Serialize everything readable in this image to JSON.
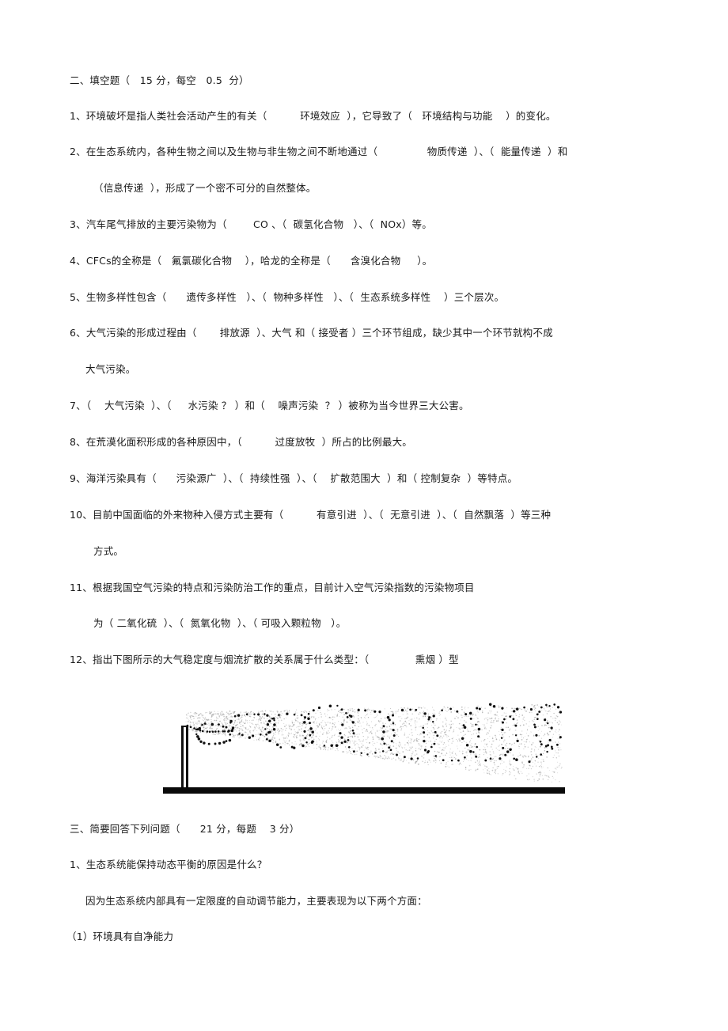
{
  "section2": {
    "heading": "二、填空题（   15 分，每空   0.5  分）",
    "questions": [
      {
        "id": "q1",
        "lines": [
          "1、环境破坏是指人类社会活动产生的有关（          环境效应  ），它导致了（   环境结构与功能    ）的变化。"
        ]
      },
      {
        "id": "q2",
        "lines": [
          "2、在生态系统内，各种生物之间以及生物与非生物之间不断地通过（               物质传递  ）、（  能量传递  ）和",
          "（信息传递  ），形成了一个密不可分的自然整体。"
        ]
      },
      {
        "id": "q3",
        "lines": [
          "3、汽车尾气排放的主要污染物为（        CO 、（  碳氢化合物   ）、（  NOx）等。"
        ]
      },
      {
        "id": "q4",
        "lines": [
          "4、CFCs的全称是（   氟氯碳化合物    ），哈龙的全称是（      含溴化合物     ）。"
        ]
      },
      {
        "id": "q5",
        "lines": [
          "5、生物多样性包含（      遗传多样性   ）、（  物种多样性   ）、（  生态系统多样性    ）三个层次。"
        ]
      },
      {
        "id": "q6",
        "lines": [
          "6、大气污染的形成过程由（       排放源  ）、大气 和（ 接受者 ）三个环节组成，缺少其中一个环节就构不成",
          "大气污染。"
        ]
      },
      {
        "id": "q7",
        "lines": [
          "7、（    大气污染  ）、（     水污染 ？ ）和（    噪声污染  ？ ）被称为当今世界三大公害。"
        ]
      },
      {
        "id": "q8",
        "lines": [
          "8、在荒漠化面积形成的各种原因中，（          过度放牧  ）所占的比例最大。"
        ]
      },
      {
        "id": "q9",
        "lines": [
          "9、海洋污染具有（      污染源广  ）、（  持续性强  ）、（    扩散范围大  ）和（ 控制复杂  ）等特点。"
        ]
      },
      {
        "id": "q10",
        "lines": [
          "10、目前中国面临的外来物种入侵方式主要有（          有意引进  ）、（  无意引进  ）、（  自然飘落  ）等三种",
          "方式。"
        ]
      },
      {
        "id": "q11",
        "lines": [
          "11、根据我国空气污染的特点和污染防治工作的重点，目前计入空气污染指数的污染物项目",
          "为（ 二氧化硫  ）、（  氮氧化物  ）、（ 可吸入颗粒物   ）。"
        ]
      },
      {
        "id": "q12",
        "lines": [
          "12、指出下图所示的大气稳定度与烟流扩散的关系属于什么类型：（              熏烟 ）型"
        ]
      }
    ],
    "figure": {
      "description": "烟囱烟流扩散示意图（熏烟型）",
      "elements": [
        "chimney",
        "ground",
        "plume"
      ]
    }
  },
  "section3": {
    "heading": "三、简要回答下列问题（      21 分，每题    3 分）",
    "q1": {
      "question": "1、生态系统能保持动态平衡的原因是什么？",
      "answer_intro": "因为生态系统内部具有一定限度的自动调节能力，主要表现为以下两个方面：",
      "points": [
        "（1）环境具有自净能力"
      ]
    }
  }
}
